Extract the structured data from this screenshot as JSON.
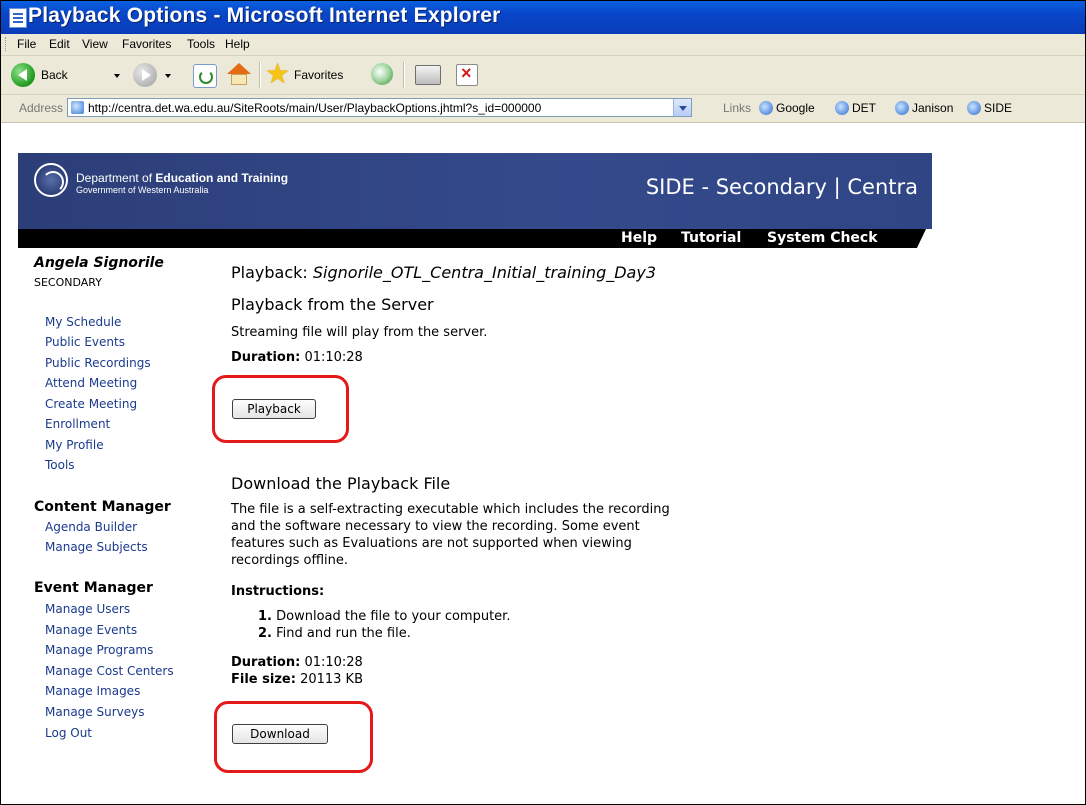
{
  "window": {
    "title": "Playback Options - Microsoft Internet Explorer"
  },
  "menu": [
    "File",
    "Edit",
    "View",
    "Favorites",
    "Tools",
    "Help"
  ],
  "toolbar": {
    "back": "Back",
    "favorites": "Favorites"
  },
  "address": {
    "label": "Address",
    "url": "http://centra.det.wa.edu.au/SiteRoots/main/User/PlaybackOptions.jhtml?s_id=000000",
    "links_label": "Links",
    "links": [
      "Google",
      "DET",
      "Janison",
      "SIDE"
    ]
  },
  "site": {
    "dept_line1_prefix": "Department of ",
    "dept_line1_bold": "Education and Training",
    "dept_line2": "Government of Western Australia",
    "side_title": "SIDE - Secondary | Centra",
    "nav": [
      "Help",
      "Tutorial",
      "System Check"
    ]
  },
  "sidebar": {
    "user_name": "Angela Signorile",
    "user_role": "SECONDARY",
    "main_links": [
      "My Schedule",
      "Public Events",
      "Public Recordings",
      "Attend Meeting",
      "Create Meeting",
      "Enrollment",
      "My Profile",
      "Tools"
    ],
    "content_manager": {
      "title": "Content Manager",
      "links": [
        "Agenda Builder",
        "Manage Subjects"
      ]
    },
    "event_manager": {
      "title": "Event Manager",
      "links": [
        "Manage Users",
        "Manage Events",
        "Manage Programs",
        "Manage Cost Centers",
        "Manage Images",
        "Manage Surveys",
        "Log Out"
      ]
    }
  },
  "main": {
    "playback_label": "Playback:",
    "playback_name": "Signorile_OTL_Centra_Initial_training_Day3",
    "server_section": {
      "title": "Playback from the Server",
      "desc": "Streaming file will play from the server.",
      "duration_label": "Duration:",
      "duration": "01:10:28",
      "button": "Playback"
    },
    "download_section": {
      "title": "Download the Playback File",
      "desc_lines": [
        "The file is a self-extracting executable which includes the recording",
        "and the software necessary to view the recording. Some event",
        "features such as Evaluations are not supported when viewing",
        "recordings offline."
      ],
      "instructions_label": "Instructions:",
      "steps": [
        {
          "num": "1.",
          "text": "Download the file to your computer."
        },
        {
          "num": "2.",
          "text": "Find and run the file."
        }
      ],
      "duration_label": "Duration:",
      "duration": "01:10:28",
      "size_label": "File size:",
      "size": "20113 KB",
      "button": "Download"
    }
  },
  "colors": {
    "title_bar": "#0846c8",
    "header_bg": "#2f4584",
    "link": "#1a3a8c",
    "highlight": "#e41a1a"
  }
}
